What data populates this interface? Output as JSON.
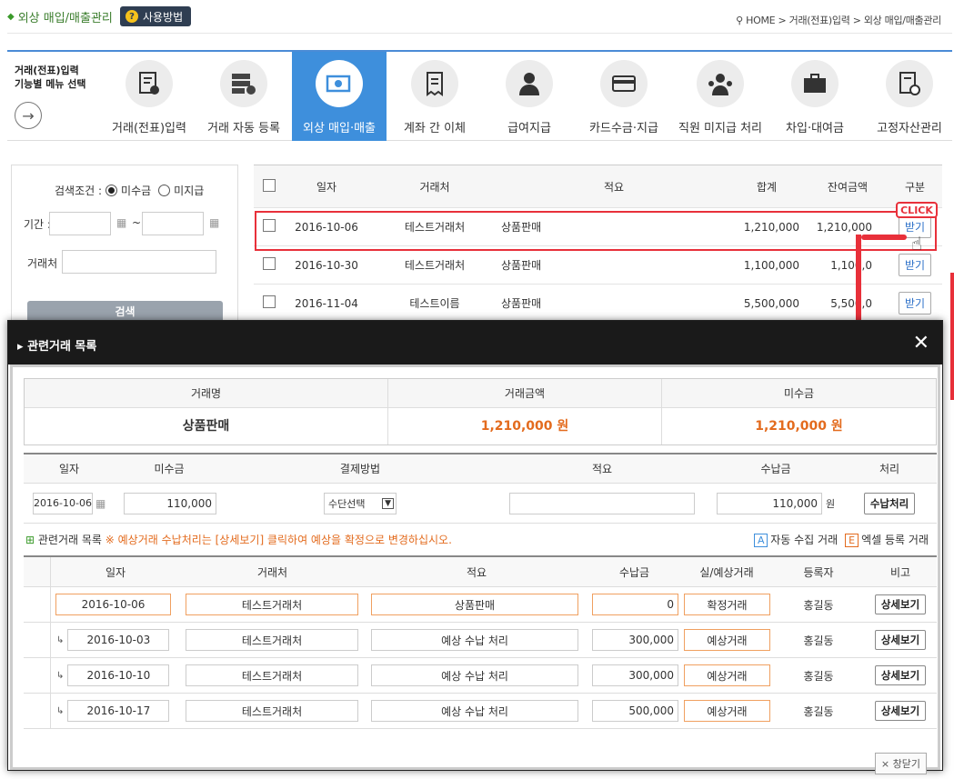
{
  "header": {
    "page_title": "외상 매입/매출관리",
    "help_label": "사용방법",
    "breadcrumb": "HOME > 거래(전표)입력 > 외상 매입/매출관리"
  },
  "menu": {
    "intro_line1": "거래(전표)입력",
    "intro_line2": "기능별 메뉴 선택",
    "items": [
      {
        "label": "거래(전표)입력",
        "icon": "document-edit-icon"
      },
      {
        "label": "거래 자동 등록",
        "icon": "server-icon"
      },
      {
        "label": "외상 매입·매출",
        "icon": "cash-icon"
      },
      {
        "label": "계좌 간 이체",
        "icon": "receipt-icon"
      },
      {
        "label": "급여지급",
        "icon": "person-icon"
      },
      {
        "label": "카드수금·지급",
        "icon": "credit-card-icon"
      },
      {
        "label": "직원 미지급 처리",
        "icon": "person-money-icon"
      },
      {
        "label": "차입·대여금",
        "icon": "briefcase-icon"
      },
      {
        "label": "고정자산관리",
        "icon": "asset-document-icon"
      }
    ]
  },
  "search": {
    "condition_label": "검색조건 :",
    "option1": "미수금",
    "option2": "미지급",
    "period_label": "기간 :",
    "tilde": "~",
    "client_label": "거래처 :",
    "search_button": "검색"
  },
  "list": {
    "headers": [
      "일자",
      "거래처",
      "적요",
      "합계",
      "잔여금액",
      "구분"
    ],
    "rows": [
      {
        "date": "2016-10-06",
        "client": "테스트거래처",
        "memo": "상품판매",
        "total": "1,210,000",
        "remain": "1,210,000",
        "action": "받기"
      },
      {
        "date": "2016-10-30",
        "client": "테스트거래처",
        "memo": "상품판매",
        "total": "1,100,000",
        "remain": "1,100,0",
        "action": "받기"
      },
      {
        "date": "2016-11-04",
        "client": "테스트이름",
        "memo": "상품판매",
        "total": "5,500,000",
        "remain": "5,500,0",
        "action": "받기"
      }
    ],
    "click_badge": "CLICK"
  },
  "modal": {
    "title": "관련거래 목록",
    "summary_headers": [
      "거래명",
      "거래금액",
      "미수금"
    ],
    "summary_values": [
      "상품판매",
      "1,210,000 원",
      "1,210,000 원"
    ],
    "form_headers": [
      "일자",
      "미수금",
      "결제방법",
      "적요",
      "수납금",
      "처리"
    ],
    "form": {
      "date": "2016-10-06",
      "unpaid": "110,000",
      "method": "수단선택",
      "memo": "",
      "amount": "110,000",
      "unit": "원",
      "process_button": "수납처리"
    },
    "section_title": "관련거래 목록",
    "section_note": "※ 예상거래 수납처리는 [상세보기] 클릭하여 예상을 확정으로 변경하십시오.",
    "legend_auto_tag": "A",
    "legend_auto": "자동 수집 거래",
    "legend_excel_tag": "E",
    "legend_excel": "엑셀 등록 거래",
    "detail_headers": [
      "일자",
      "거래처",
      "적요",
      "수납금",
      "실/예상거래",
      "등록자",
      "비고"
    ],
    "detail_rows": [
      {
        "date": "2016-10-06",
        "client": "테스트거래처",
        "memo": "상품판매",
        "amount": "0",
        "type": "확정거래",
        "user": "홍길동",
        "button": "상세보기",
        "sub": false
      },
      {
        "date": "2016-10-03",
        "client": "테스트거래처",
        "memo": "예상 수납 처리",
        "amount": "300,000",
        "type": "예상거래",
        "user": "홍길동",
        "button": "상세보기",
        "sub": true
      },
      {
        "date": "2016-10-10",
        "client": "테스트거래처",
        "memo": "예상 수납 처리",
        "amount": "300,000",
        "type": "예상거래",
        "user": "홍길동",
        "button": "상세보기",
        "sub": true
      },
      {
        "date": "2016-10-17",
        "client": "테스트거래처",
        "memo": "예상 수납 처리",
        "amount": "500,000",
        "type": "예상거래",
        "user": "홍길동",
        "button": "상세보기",
        "sub": true
      }
    ],
    "close_label": "창닫기"
  },
  "colors": {
    "accent": "#3e8fdc",
    "highlight": "#e8303a",
    "orange": "#e36b1e"
  }
}
